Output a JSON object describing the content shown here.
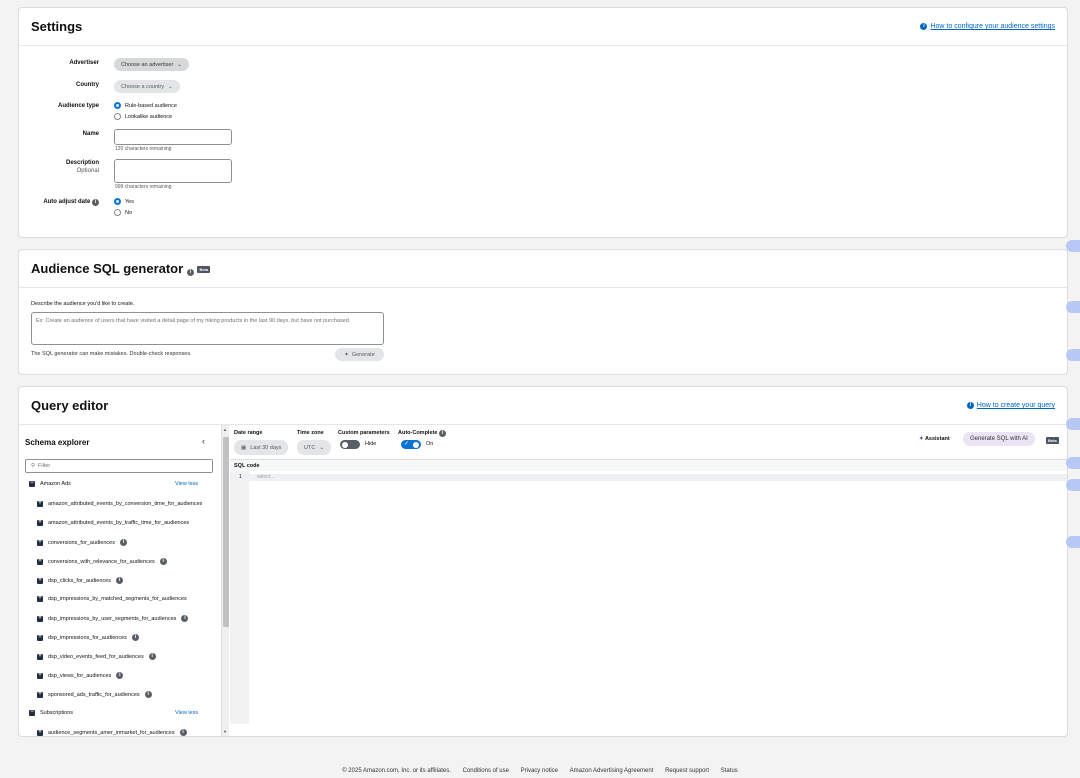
{
  "settings": {
    "title": "Settings",
    "help_link": "How to configure your audience settings",
    "advertiser": {
      "label": "Advertiser",
      "value": "Choose an advertiser"
    },
    "country": {
      "label": "Country",
      "value": "Choose a country"
    },
    "audience_type": {
      "label": "Audience type",
      "options": [
        "Rule-based audience",
        "Lookalike audience"
      ],
      "selected": "Rule-based audience"
    },
    "name": {
      "label": "Name",
      "value": "",
      "hint": "120 characters remaining"
    },
    "description": {
      "label": "Description",
      "sublabel": "Optional",
      "value": "",
      "hint": "999 characters remaining"
    },
    "auto_adjust": {
      "label": "Auto adjust date",
      "options": [
        "Yes",
        "No"
      ],
      "selected": "Yes"
    }
  },
  "sql_generator": {
    "title": "Audience SQL generator",
    "badge": "Beta",
    "prompt": "Describe the audience you'd like to create.",
    "placeholder": "Ex: Create an audience of users that have visited a detail page of my hiking products in the last 90 days, but have not purchased.",
    "disclaimer": "The SQL generator can make mistakes. Double-check responses.",
    "generate_label": "Generate"
  },
  "query_editor": {
    "title": "Query editor",
    "help_link": "How to create your query",
    "schema": {
      "title": "Schema explorer",
      "filter_placeholder": "Filter",
      "groups": [
        {
          "name": "Amazon Ads",
          "toggle": "View less"
        },
        {
          "name": "Subscriptions",
          "toggle": "View less"
        }
      ],
      "amazon_ads_tables": [
        "amazon_attributed_events_by_conversion_time_for_audiences",
        "amazon_attributed_events_by_traffic_time_for_audiences",
        "conversions_for_audiences",
        "conversions_with_relevance_for_audiences",
        "dsp_clicks_for_audiences",
        "dsp_impressions_by_matched_segments_for_audiences",
        "dsp_impressions_by_user_segments_for_audiences",
        "dsp_impressions_for_audiences",
        "dsp_video_events_feed_for_audiences",
        "dsp_views_for_audiences",
        "sponsored_ads_traffic_for_audiences"
      ],
      "subscription_tables": [
        "audience_segments_amer_inmarket_for_audiences"
      ]
    },
    "date_range": {
      "label": "Date range",
      "value": "Last 30 days"
    },
    "time_zone": {
      "label": "Time zone",
      "value": "UTC"
    },
    "custom_params": {
      "label": "Custom parameters",
      "state": "Hide"
    },
    "autocomplete": {
      "label": "Auto-Complete",
      "state": "On"
    },
    "assistant_label": "Assistant",
    "generate_ai_label": "Generate SQL with AI",
    "beta_badge": "Beta",
    "sql_code_label": "SQL code",
    "line_number": "1",
    "code_placeholder": "select..."
  },
  "footer": {
    "copyright": "© 2025 Amazon.com, Inc. or its affiliates.",
    "links": [
      "Conditions of use",
      "Privacy notice",
      "Amazon Advertising Agreement",
      "Request support",
      "Status"
    ]
  },
  "colors": {
    "link": "#0066c0",
    "toggle_on": "#0972d3",
    "toggle_off": "#5a5f66",
    "ai_button": "#ebe4f5"
  }
}
